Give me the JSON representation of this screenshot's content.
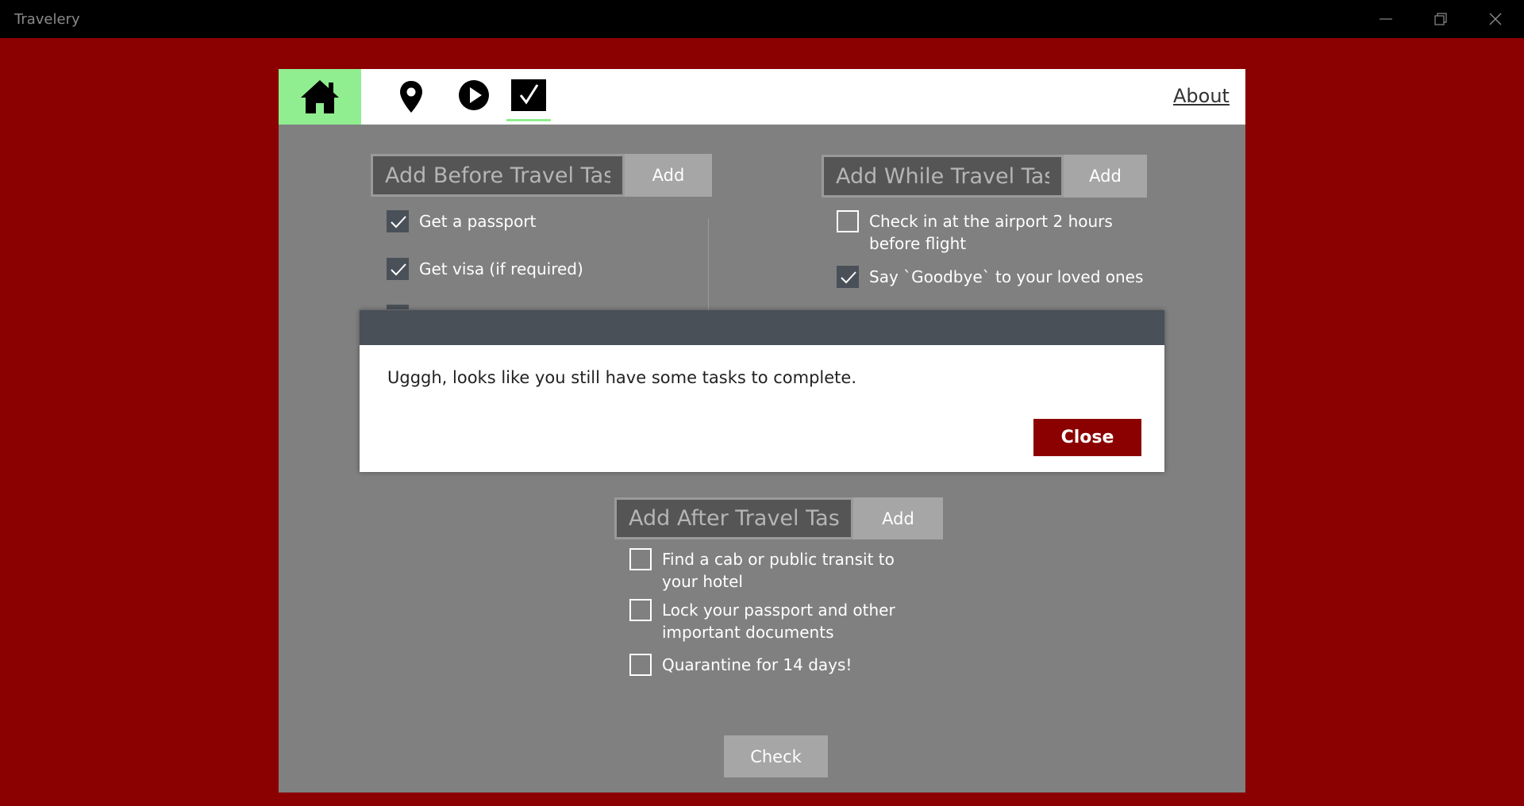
{
  "window": {
    "title": "Travelery"
  },
  "nav": {
    "items": [
      {
        "icon": "home-icon",
        "active": true
      },
      {
        "icon": "location-pin-icon"
      },
      {
        "icon": "play-icon"
      },
      {
        "icon": "checkbox-icon",
        "selected": true
      }
    ],
    "about_label": "About"
  },
  "before": {
    "placeholder": "Add Before Travel Task",
    "add_label": "Add",
    "tasks": [
      {
        "label": "Get a passport",
        "checked": true
      },
      {
        "label": "Get visa (if required)",
        "checked": true
      }
    ]
  },
  "while": {
    "placeholder": "Add While Travel Task",
    "add_label": "Add",
    "tasks": [
      {
        "label": "Check in at the airport 2 hours before flight",
        "checked": false
      },
      {
        "label": "Say `Goodbye` to your loved ones",
        "checked": true
      }
    ]
  },
  "after": {
    "placeholder": "Add After Travel Task",
    "add_label": "Add",
    "tasks": [
      {
        "label": "Find a cab or public transit to your hotel",
        "checked": false
      },
      {
        "label": "Lock your passport and other important documents",
        "checked": false
      },
      {
        "label": "Quarantine for 14 days!",
        "checked": false
      }
    ]
  },
  "check_label": "Check",
  "dialog": {
    "message": "Ugggh, looks like you still have some tasks to complete.",
    "close_label": "Close"
  },
  "colors": {
    "background": "#8b0000",
    "accent_green": "#90ee90",
    "panel_gray": "#808080",
    "dialog_header": "#4a5058",
    "close_button": "#8b0000"
  }
}
